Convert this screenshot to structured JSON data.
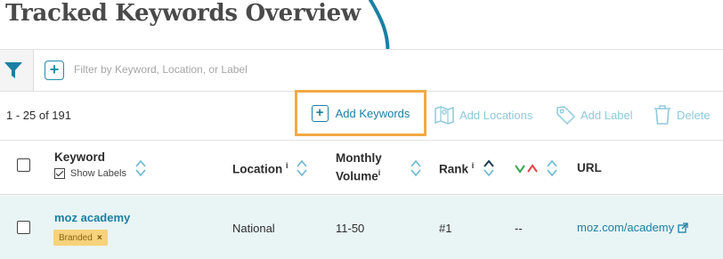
{
  "page": {
    "title": "Tracked Keywords Overview"
  },
  "filter": {
    "placeholder": "Filter by Keyword, Location, or Label"
  },
  "pagination": {
    "count_text": "1 - 25 of 191"
  },
  "toolbar": {
    "add_keywords": "Add Keywords",
    "add_locations": "Add Locations",
    "add_label": "Add Label",
    "delete": "Delete"
  },
  "table": {
    "headers": {
      "keyword": "Keyword",
      "show_labels": "Show Labels",
      "location": "Location",
      "monthly_volume_line1": "Monthly",
      "monthly_volume_line2": "Volume",
      "rank": "Rank",
      "url": "URL",
      "info_marker": "i"
    },
    "rows": [
      {
        "keyword": "moz academy",
        "label": "Branded",
        "label_remove": "×",
        "location": "National",
        "monthly_volume": "11-50",
        "rank": "#1",
        "rank_change": "--",
        "url": "moz.com/academy"
      }
    ]
  },
  "colors": {
    "accent": "#1a7fa3",
    "highlight_border": "#f3a945",
    "row_background": "#e9f4f4",
    "badge": "#f6d27a",
    "disabled_action": "#8ec9db"
  },
  "icons": [
    "filter-icon",
    "plus-icon",
    "map-icon",
    "tag-icon",
    "trash-icon",
    "sort-icon",
    "rank-trend-icon",
    "external-link-icon",
    "pointer-arrow-icon"
  ]
}
